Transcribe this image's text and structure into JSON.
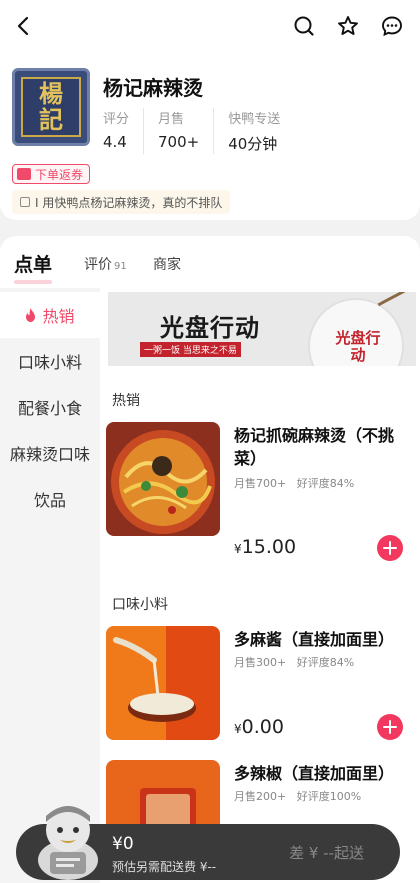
{
  "store": {
    "name": "杨记麻辣烫",
    "logo_chars": [
      "楊",
      "記"
    ],
    "stats": [
      {
        "label": "评分",
        "value": "4.4"
      },
      {
        "label": "月售",
        "value": "700+"
      },
      {
        "label": "快鸭专送",
        "value": "40分钟"
      }
    ],
    "coupon": "下单返券",
    "notice": "I 用快鸭点杨记麻辣烫，真的不排队"
  },
  "tabs": [
    {
      "label": "点单",
      "count": ""
    },
    {
      "label": "评价",
      "count": "91"
    },
    {
      "label": "商家",
      "count": ""
    }
  ],
  "sidebar": [
    {
      "label": "热销",
      "active": true
    },
    {
      "label": "口味小料"
    },
    {
      "label": "配餐小食"
    },
    {
      "label": "麻辣烫口味"
    },
    {
      "label": "饮品"
    }
  ],
  "banner": {
    "title": "光盘行动",
    "sub": "一粥一饭 当思来之不易",
    "plate_text": "光盘行动"
  },
  "sections": [
    {
      "title": "热销",
      "dishes": [
        {
          "name": "杨记抓碗麻辣烫（不挑菜）",
          "sales": "月售700+",
          "rating": "好评度84%",
          "currency": "¥",
          "price": "15.00"
        }
      ]
    },
    {
      "title": "口味小料",
      "dishes": [
        {
          "name": "多麻酱（直接加面里）",
          "sales": "月售300+",
          "rating": "好评度84%",
          "currency": "¥",
          "price": "0.00"
        },
        {
          "name": "多辣椒（直接加面里）",
          "sales": "月售200+",
          "rating": "好评度100%",
          "currency": "¥",
          "price": ""
        }
      ]
    }
  ],
  "cart": {
    "amount": "¥0",
    "fee": "预估另需配送费 ¥--",
    "diff": "差 ¥ --起送"
  },
  "colors": {
    "accent": "#ef4a6a",
    "add_button": "#f2385f",
    "cart_bg": "#3a3a3a"
  }
}
